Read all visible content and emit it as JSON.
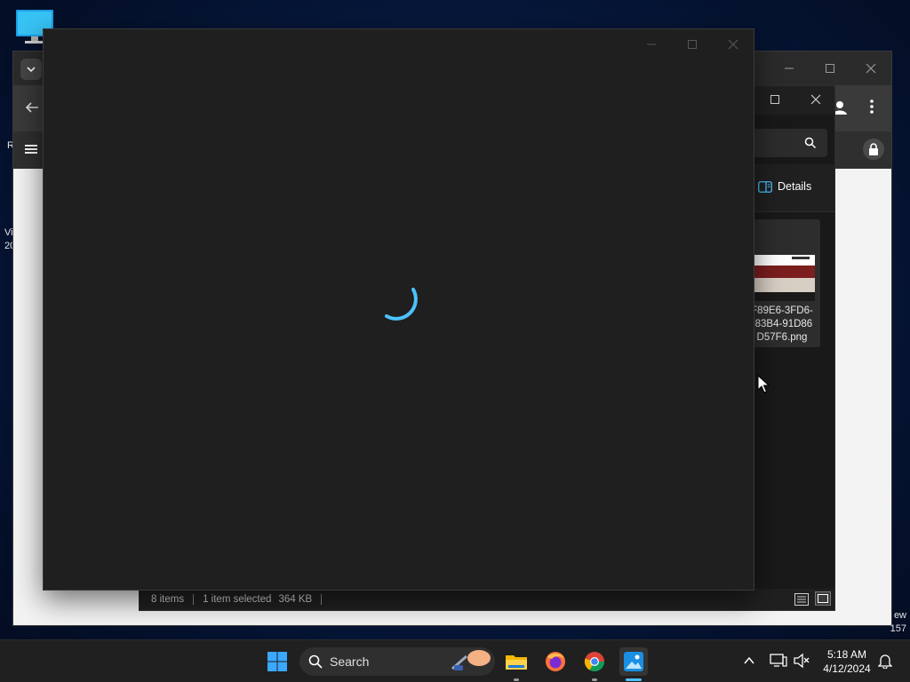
{
  "desktop": {
    "icon_name": "monitor-icon",
    "left_fragments": {
      "r_text": "R",
      "vi_text": "Vi",
      "year_fragment": "20"
    },
    "right_fragments": {
      "ew_text": "ew",
      "num_text": "157"
    }
  },
  "explorer": {
    "search_icon": "search-icon",
    "details_label": "Details",
    "file": {
      "name": "F89E6-3FD6-\n-83B4-91D86\nD57F6.png"
    },
    "status": {
      "items": "8 items",
      "selected": "1 item selected",
      "size": "364 KB"
    }
  },
  "viewer": {
    "state": "loading",
    "spinner_icon": "loading-spinner-icon"
  },
  "taskbar": {
    "search_label": "Search",
    "time": "5:18 AM",
    "date": "4/12/2024",
    "pinned": [
      "start-icon",
      "file-explorer-icon",
      "firefox-icon",
      "chrome-icon",
      "photos-icon"
    ]
  },
  "colors": {
    "accent": "#4cc2ff",
    "taskbar": "#202020",
    "window_dark": "#1f1f1f"
  }
}
